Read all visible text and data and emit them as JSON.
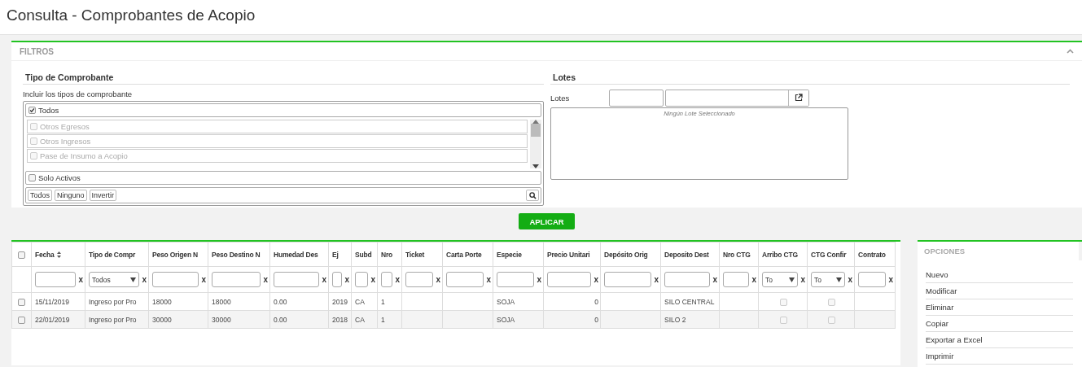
{
  "page_title": "Consulta - Comprobantes de Acopio",
  "filters": {
    "title": "FILTROS",
    "expanded": true,
    "tipo": {
      "heading": "Tipo de Comprobante",
      "hint": "Incluir los tipos de comprobante",
      "all": {
        "label": "Todos",
        "checked": true
      },
      "items": [
        {
          "label": "Otros Egresos",
          "checked": false,
          "disabled": true
        },
        {
          "label": "Otros Ingresos",
          "checked": false,
          "disabled": true
        },
        {
          "label": "Pase de Insumo a Acopio",
          "checked": false,
          "disabled": true
        }
      ],
      "solo_activos": {
        "label": "Solo Activos",
        "checked": false
      },
      "buttons": [
        "Todos",
        "Ninguno",
        "Invertir"
      ]
    },
    "lotes": {
      "heading": "Lotes",
      "label": "Lotes",
      "empty_text": "Ningún Lote Seleccionado"
    }
  },
  "apply_button": "APLICAR",
  "grid": {
    "select_all": {
      "checked": false
    },
    "columns": [
      {
        "label": "Fecha",
        "sortable": true,
        "filter": {
          "kind": "text",
          "clear": "x"
        }
      },
      {
        "label": "Tipo de Compr",
        "filter": {
          "kind": "select",
          "value": "Todos",
          "clear": "x"
        }
      },
      {
        "label": "Peso Origen N",
        "filter": {
          "kind": "text",
          "clear": "x"
        }
      },
      {
        "label": "Peso Destino N",
        "filter": {
          "kind": "text",
          "clear": "x"
        }
      },
      {
        "label": "Humedad Des",
        "filter": {
          "kind": "text",
          "clear": "x"
        }
      },
      {
        "label": "Ej",
        "filter": {
          "kind": "text",
          "clear": "x"
        }
      },
      {
        "label": "Subd",
        "filter": {
          "kind": "text",
          "clear": "x"
        }
      },
      {
        "label": "Nro",
        "filter": {
          "kind": "text",
          "clear": "x"
        }
      },
      {
        "label": "Ticket",
        "filter": {
          "kind": "text",
          "clear": "x"
        }
      },
      {
        "label": "Carta Porte",
        "filter": {
          "kind": "text",
          "clear": "x"
        }
      },
      {
        "label": "Especie",
        "filter": {
          "kind": "text",
          "clear": "x"
        }
      },
      {
        "label": "Precio Unitari",
        "filter": {
          "kind": "text",
          "clear": "x"
        }
      },
      {
        "label": "Depósito Orig",
        "filter": {
          "kind": "text",
          "clear": "x"
        }
      },
      {
        "label": "Deposito Dest",
        "filter": {
          "kind": "text",
          "clear": "x"
        }
      },
      {
        "label": "Nro CTG",
        "filter": {
          "kind": "text",
          "clear": "x"
        }
      },
      {
        "label": "Arribo CTG",
        "filter": {
          "kind": "select",
          "value": "To",
          "clear": "x"
        }
      },
      {
        "label": "CTG Confir",
        "filter": {
          "kind": "select",
          "value": "To",
          "clear": "x"
        }
      },
      {
        "label": "Contrato",
        "filter": {
          "kind": "text",
          "clear": "x"
        }
      }
    ],
    "rows": [
      {
        "selected": false,
        "cells": [
          {
            "kind": "text",
            "text": "15/11/2019"
          },
          {
            "kind": "text",
            "text": "Ingreso por Pro"
          },
          {
            "kind": "text",
            "text": "18000"
          },
          {
            "kind": "text",
            "text": "18000"
          },
          {
            "kind": "text",
            "text": "0.00"
          },
          {
            "kind": "text",
            "text": "2019"
          },
          {
            "kind": "text",
            "text": "CA"
          },
          {
            "kind": "text",
            "text": "1"
          },
          {
            "kind": "empty"
          },
          {
            "kind": "empty"
          },
          {
            "kind": "text",
            "text": "SOJA"
          },
          {
            "kind": "number",
            "text": "0"
          },
          {
            "kind": "empty"
          },
          {
            "kind": "text",
            "text": "SILO CENTRAL"
          },
          {
            "kind": "empty"
          },
          {
            "kind": "check",
            "checked": false
          },
          {
            "kind": "check",
            "checked": false
          },
          {
            "kind": "empty"
          }
        ]
      },
      {
        "selected": false,
        "cells": [
          {
            "kind": "text",
            "text": "22/01/2019"
          },
          {
            "kind": "text",
            "text": "Ingreso por Pro"
          },
          {
            "kind": "text",
            "text": "30000"
          },
          {
            "kind": "text",
            "text": "30000"
          },
          {
            "kind": "text",
            "text": "0.00"
          },
          {
            "kind": "text",
            "text": "2018"
          },
          {
            "kind": "text",
            "text": "CA"
          },
          {
            "kind": "text",
            "text": "1"
          },
          {
            "kind": "empty"
          },
          {
            "kind": "empty"
          },
          {
            "kind": "text",
            "text": "SOJA"
          },
          {
            "kind": "number",
            "text": "0"
          },
          {
            "kind": "empty"
          },
          {
            "kind": "text",
            "text": "SILO 2"
          },
          {
            "kind": "empty"
          },
          {
            "kind": "check",
            "checked": false
          },
          {
            "kind": "check",
            "checked": false
          },
          {
            "kind": "empty"
          }
        ]
      }
    ]
  },
  "options": {
    "title": "OPCIONES",
    "items": [
      "Nuevo",
      "Modificar",
      "Eliminar",
      "Copiar",
      "Exportar a Excel",
      "Imprimir"
    ]
  }
}
